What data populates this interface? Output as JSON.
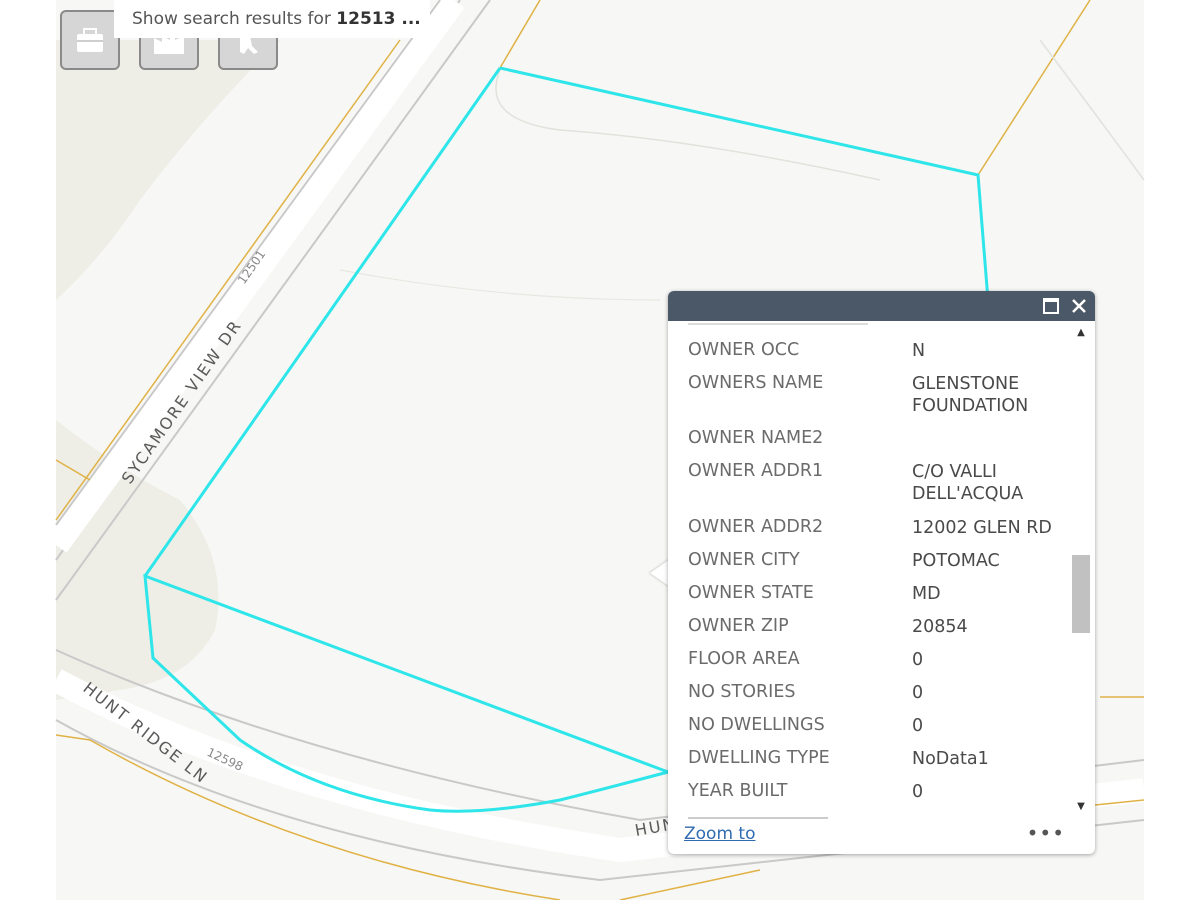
{
  "search": {
    "prefix": "Show search results for ",
    "query": "12513 ..."
  },
  "toolbar": {
    "buttons": [
      "toolbox-icon",
      "factory-icon",
      "street-view-icon"
    ]
  },
  "map": {
    "streets": {
      "sycamore": "SYCAMORE VIEW DR",
      "hunt_ridge": "HUNT RIDGE LN",
      "hunt_ridge_partial": "HUN"
    },
    "address_labels": [
      "12501",
      "12598"
    ],
    "colors": {
      "parcel_highlight": "#2ee6ea",
      "property_line": "#e0b246",
      "road_edge": "#c9c9c9",
      "background": "#f7f7f5"
    }
  },
  "popup": {
    "rows": [
      {
        "label": "OWNER OCC",
        "value": "N"
      },
      {
        "label": "OWNERS NAME",
        "value": "GLENSTONE FOUNDATION"
      },
      {
        "label": "OWNER NAME2",
        "value": ""
      },
      {
        "label": "OWNER ADDR1",
        "value": "C/O VALLI DELL'ACQUA"
      },
      {
        "label": "OWNER ADDR2",
        "value": "12002 GLEN RD"
      },
      {
        "label": "OWNER CITY",
        "value": "POTOMAC"
      },
      {
        "label": "OWNER STATE",
        "value": "MD"
      },
      {
        "label": "OWNER ZIP",
        "value": "20854"
      },
      {
        "label": "FLOOR AREA",
        "value": "0"
      },
      {
        "label": "NO STORIES",
        "value": "0"
      },
      {
        "label": "NO DWELLINGS",
        "value": "0"
      },
      {
        "label": "DWELLING TYPE",
        "value": "NoData1"
      },
      {
        "label": "YEAR BUILT",
        "value": "0"
      }
    ],
    "zoom_link": "Zoom to",
    "more": "•••",
    "maximize_icon": "maximize-icon",
    "close_icon": "close-icon"
  }
}
